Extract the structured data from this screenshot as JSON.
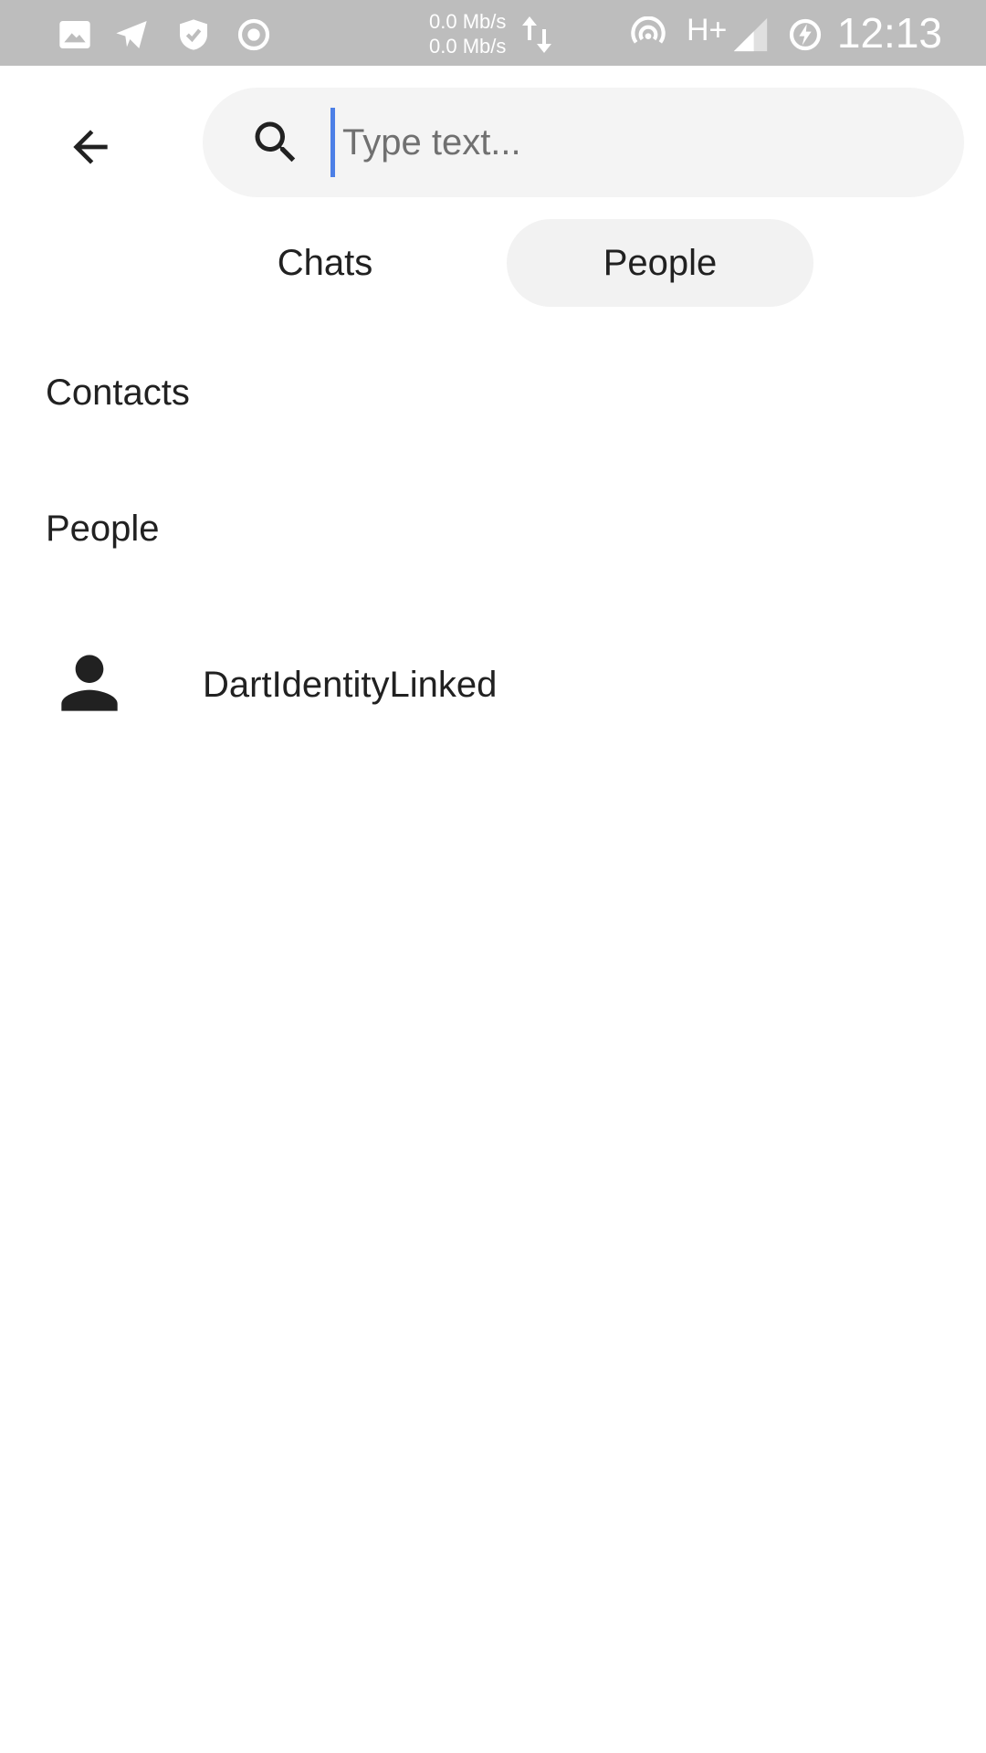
{
  "status_bar": {
    "upload_speed": "0.0 Mb/s",
    "download_speed": "0.0 Mb/s",
    "network_type": "H+",
    "time": "12:13",
    "icons": [
      "image-icon",
      "telegram-icon",
      "shield-icon",
      "record-icon",
      "transfer-arrows-icon",
      "hotspot-icon",
      "signal-icon",
      "battery-charging-icon"
    ]
  },
  "header": {
    "back_icon": "arrow-left-icon",
    "search": {
      "icon": "search-icon",
      "placeholder": "Type text...",
      "value": ""
    }
  },
  "tabs": [
    {
      "label": "Chats",
      "selected": false
    },
    {
      "label": "People",
      "selected": true
    }
  ],
  "sections": {
    "contacts_heading": "Contacts",
    "people_heading": "People"
  },
  "people": [
    {
      "name": "DartIdentityLinked",
      "icon": "person-icon"
    }
  ],
  "colors": {
    "status_bar": "#bdbdbd",
    "search_background": "#f4f4f4",
    "selected_tab_background": "#f2f2f2",
    "cursor": "#4c7fe6",
    "text": "#212121"
  }
}
